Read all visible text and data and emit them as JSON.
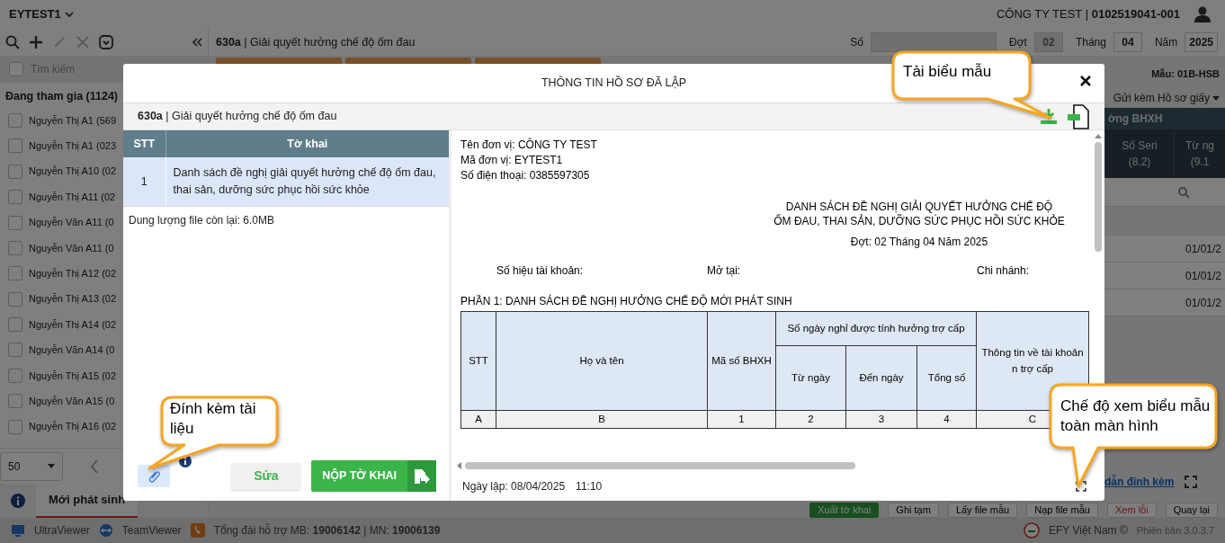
{
  "top_bar": {
    "unit": "EYTEST1",
    "company": "CÔNG TY TEST | **0102519041-001**"
  },
  "sidebar": {
    "search_placeholder": "Tìm kiếm",
    "group": "Đang tham gia (1124)",
    "items": [
      {
        "label": "Nguyễn Thị A1 (569",
        "checked": false
      },
      {
        "label": "Nguyễn Thị A1 (023",
        "checked": false
      },
      {
        "label": "Nguyễn Thị A10 (02",
        "checked": false
      },
      {
        "label": "Nguyễn Thị A11 (02",
        "checked": false
      },
      {
        "label": "Nguyễn Văn A11 (0",
        "checked": false
      },
      {
        "label": "Nguyễn Văn A11 (0",
        "checked": false
      },
      {
        "label": "Nguyễn Thị A12 (02",
        "checked": false
      },
      {
        "label": "Nguyễn Thị A13 (02",
        "checked": false
      },
      {
        "label": "Nguyễn Thị A14 (02",
        "checked": false
      },
      {
        "label": "Nguyễn Văn A14 (0",
        "checked": false
      },
      {
        "label": "Nguyễn Thị A15 (02",
        "checked": false
      },
      {
        "label": "Nguyễn Văn A15 (0",
        "checked": false
      },
      {
        "label": "Nguyễn Thị A16 (02",
        "checked": false
      }
    ],
    "page_size": "50",
    "tabs": [
      {
        "label": "Mới phát sinh",
        "selected": true
      }
    ]
  },
  "form_header": {
    "title": "**630a** | Giải quyết hưởng chế độ ốm đau",
    "fields": [
      {
        "label": "Số",
        "disabled": true
      },
      {
        "label": "Đợt",
        "value": "02",
        "disabled": true
      },
      {
        "label": "Tháng",
        "value": "04",
        "disabled": false
      },
      {
        "label": "Năm",
        "value": "2025",
        "disabled": false
      }
    ]
  },
  "form_panel": {
    "template": "Mẫu: 01B-HSB",
    "attachment_mode": "Gửi kèm Hồ sơ giấy",
    "group_header": "ờng BHXH",
    "columns": [
      {
        "label": "Số Seri",
        "code": "(8.2)"
      },
      {
        "label": "Từ ng",
        "code": "(9.1"
      }
    ],
    "rows": [
      "01/01/2",
      "01/01/2",
      "01/01/2"
    ],
    "attachment_link": "dẫn đính kèm"
  },
  "actions": [
    {
      "label": "Xuất tờ khai",
      "kind": "primary"
    },
    {
      "label": "Ghi tạm",
      "kind": "default"
    },
    {
      "label": "Lấy file mẫu",
      "kind": "default"
    },
    {
      "label": "Nạp file mẫu",
      "kind": "default"
    },
    {
      "label": "Xem lỗi",
      "kind": "danger"
    },
    {
      "label": "Quay lại",
      "kind": "default"
    }
  ],
  "status_bar": {
    "tools": [
      {
        "label": "UltraViewer",
        "kind": "monitor"
      },
      {
        "label": "TeamViewer",
        "kind": "remote"
      }
    ],
    "hotline": "Tổng đài hỗ trợ MB: **19006142** | MN: **19006139**",
    "vendor": "EFY Việt Nam ©",
    "version": "Phiên bản 3.0.3.7"
  },
  "modal": {
    "title": "THÔNG TIN HỒ SƠ ĐÃ LẬP",
    "name": "**630a** | Giải quyết hưởng chế độ ốm đau",
    "columns": [
      "STT",
      "Tờ khai"
    ],
    "rows": [
      {
        "no": "1",
        "name": "Danh sách đề nghị giải quyết hưởng chế độ ốm đau, thai sản, dưỡng sức phục hồi sức khỏe",
        "selected": true
      }
    ],
    "quota": "Dung lượng file còn lại: 6.0MB",
    "edit_button": "Sửa",
    "submit_button": "NỘP TỜ KHAI",
    "preview": {
      "info": [
        "Tên đơn vị: CÔNG TY TEST",
        "Mã đơn vị: EYTEST1",
        "Số điện thoại: 0385597305"
      ],
      "title": [
        "DANH SÁCH ĐỀ NGHỊ GIẢI QUYẾT HƯỞNG CHẾ ĐỘ",
        "ỐM ĐAU, THAI SẢN, DƯỠNG SỨC PHỤC HỒI SỨC KHỎE"
      ],
      "period": "Đợt: 02 Tháng 04 Năm 2025",
      "account_fields": [
        "Số hiệu tài khoản:",
        "Mở tại:",
        "Chi nhánh:"
      ],
      "section": "PHẦN 1: DANH SÁCH ĐỀ NGHỊ HƯỞNG CHẾ ĐỘ MỚI PHÁT SINH",
      "table": {
        "columns": [
          {
            "label": "STT"
          },
          {
            "label": "Họ và tên"
          },
          {
            "label": "Mã số BHXH"
          },
          {
            "label": "Số ngày nghỉ được tính hưởng trợ cấp",
            "children": [
              "Từ ngày",
              "Đến ngày",
              "Tổng số"
            ]
          },
          {
            "label": "Thông tin về tài khoản n trợ cấp"
          }
        ],
        "codes": [
          "A",
          "B",
          "1",
          "2",
          "3",
          "4",
          "C"
        ]
      }
    },
    "created": "Ngày lập: 08/04/2025",
    "time": "11:10"
  },
  "callouts": [
    {
      "text": "Tải biểu mẫu"
    },
    {
      "text": "Đính kèm tài liệu"
    },
    {
      "text": "Chế độ xem biểu mẫu toàn màn hình"
    }
  ]
}
